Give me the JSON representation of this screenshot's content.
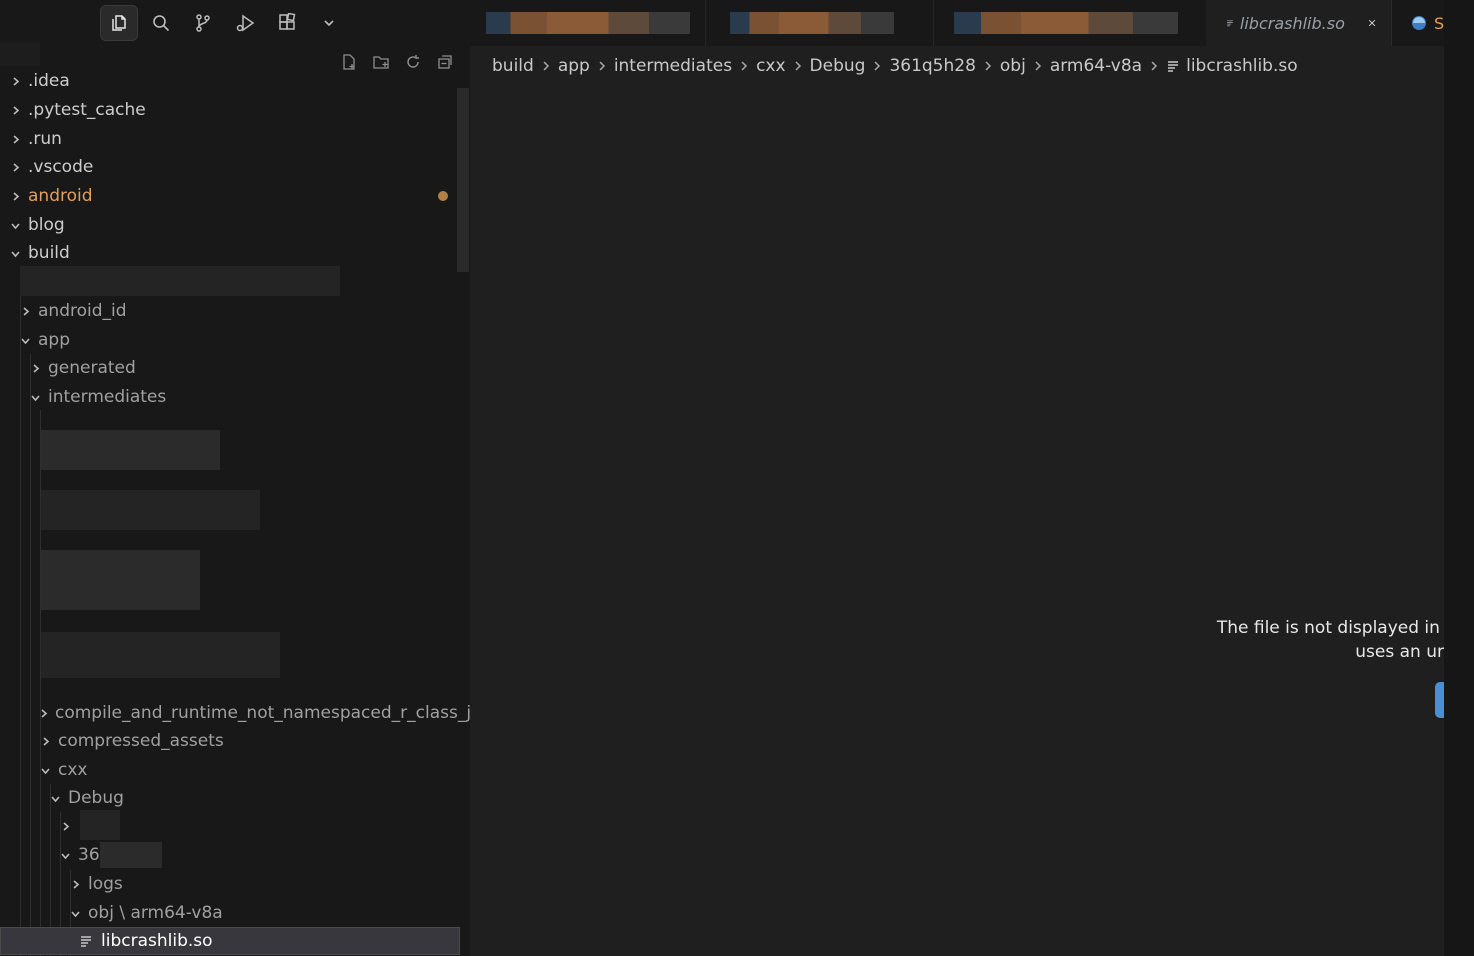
{
  "activity_bar": {
    "items": [
      {
        "name": "explorer-icon",
        "active": true
      },
      {
        "name": "search-icon",
        "active": false
      },
      {
        "name": "source-control-icon",
        "active": false
      },
      {
        "name": "run-debug-icon",
        "active": false
      },
      {
        "name": "extensions-icon",
        "active": false
      },
      {
        "name": "chevron-down-icon",
        "active": false
      }
    ]
  },
  "explorer": {
    "actions": [
      "new-file-icon",
      "new-folder-icon",
      "refresh-icon",
      "collapse-all-icon"
    ],
    "tree": [
      {
        "label": ".idea",
        "expanded": false
      },
      {
        "label": ".pytest_cache",
        "expanded": false
      },
      {
        "label": ".run",
        "expanded": false
      },
      {
        "label": ".vscode",
        "expanded": false
      },
      {
        "label": "android",
        "expanded": false,
        "modified": true
      },
      {
        "label": "blog",
        "expanded": true
      },
      {
        "label": "build",
        "expanded": true
      },
      {
        "label": "android_id",
        "expanded": false
      },
      {
        "label": "app",
        "expanded": true
      },
      {
        "label": "generated",
        "expanded": false
      },
      {
        "label": "intermediates",
        "expanded": true
      },
      {
        "label": "compile_and_runtime_not_namespaced_r_class_jar",
        "expanded": false
      },
      {
        "label": "compressed_assets",
        "expanded": false
      },
      {
        "label": "cxx",
        "expanded": true
      },
      {
        "label": "Debug",
        "expanded": true
      },
      {
        "label": "",
        "expanded": false
      },
      {
        "label": "36",
        "expanded": true
      },
      {
        "label": "logs",
        "expanded": false
      },
      {
        "label": "obj \\ arm64-v8a",
        "expanded": true
      },
      {
        "label": "libcrashlib.so",
        "file": true,
        "selected": true
      }
    ]
  },
  "tabs": {
    "active": {
      "label": "libcrashlib.so"
    },
    "next": {
      "label": "S"
    }
  },
  "breadcrumb": [
    "build",
    "app",
    "intermediates",
    "cxx",
    "Debug",
    "361q5h28",
    "obj",
    "arm64-v8a",
    "libcrashlib.so"
  ],
  "editor": {
    "notice_line1": "The file is not displayed in t",
    "notice_line2": "uses an ur"
  },
  "colors": {
    "modified": "#e2a15a",
    "accent_button": "#4a8fd4",
    "selection": "#37373d"
  }
}
